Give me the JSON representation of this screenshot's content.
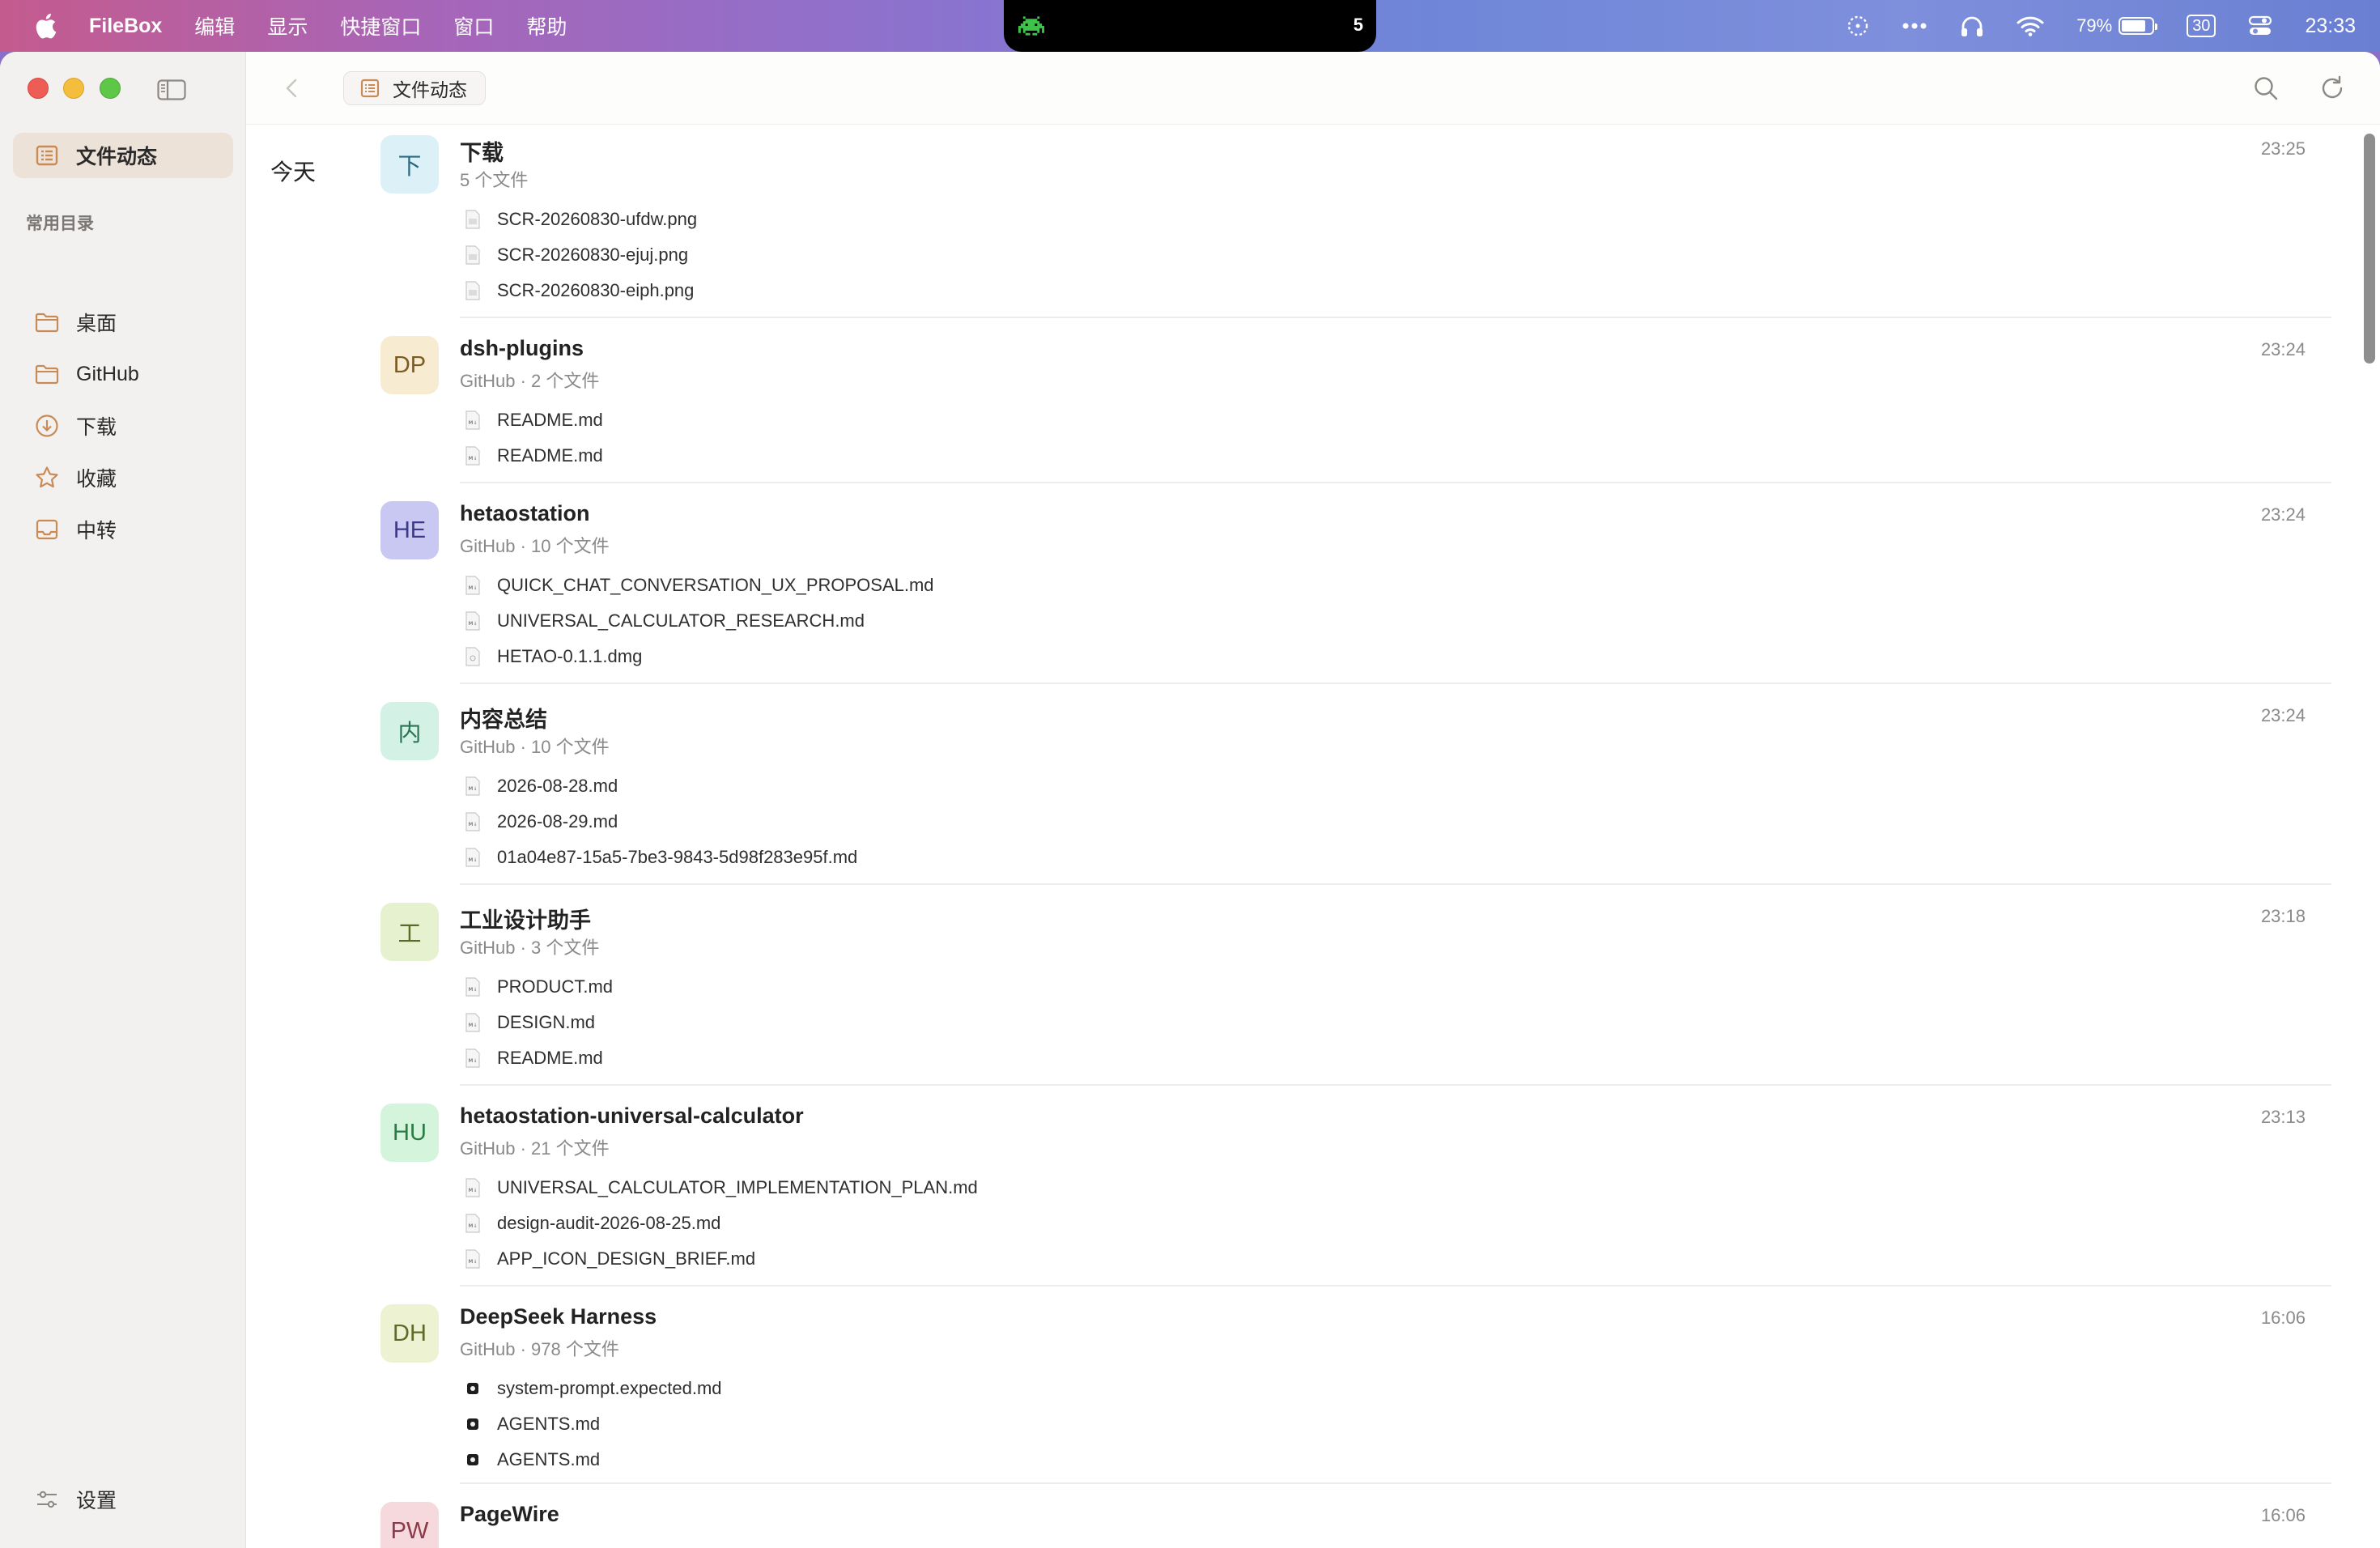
{
  "menubar": {
    "app_name": "FileBox",
    "menus": [
      "编辑",
      "显示",
      "快捷窗口",
      "窗口",
      "帮助"
    ],
    "notch_count": "5",
    "battery_percent": "79%",
    "battery_level": 0.79,
    "calendar_day": "30",
    "clock": "23:33"
  },
  "sidebar": {
    "active_item": {
      "label": "文件动态",
      "icon": "list-icon"
    },
    "section_title": "常用目录",
    "items": [
      {
        "label": "桌面",
        "icon": "folder-icon"
      },
      {
        "label": "GitHub",
        "icon": "folder-icon"
      },
      {
        "label": "下载",
        "icon": "download-icon"
      },
      {
        "label": "收藏",
        "icon": "star-icon"
      },
      {
        "label": "中转",
        "icon": "inbox-icon"
      }
    ],
    "settings_label": "设置"
  },
  "toolbar": {
    "breadcrumb": "文件动态"
  },
  "content": {
    "day_label": "今天",
    "groups": [
      {
        "avatar": "下",
        "avatar_bg": "#dbf0f7",
        "avatar_fg": "#2f6b80",
        "title": "下载",
        "subtitle": "5 个文件",
        "time": "23:25",
        "files": [
          {
            "name": "SCR-20260830-ufdw.png",
            "icon": "image-file-icon"
          },
          {
            "name": "SCR-20260830-ejuj.png",
            "icon": "image-file-icon"
          },
          {
            "name": "SCR-20260830-eiph.png",
            "icon": "image-file-icon"
          }
        ]
      },
      {
        "avatar": "DP",
        "avatar_bg": "#f7ecd2",
        "avatar_fg": "#7b5b22",
        "title": "dsh-plugins",
        "subtitle": "GitHub · 2 个文件",
        "time": "23:24",
        "files": [
          {
            "name": "README.md",
            "icon": "markdown-file-icon"
          },
          {
            "name": "README.md",
            "icon": "markdown-file-icon"
          }
        ]
      },
      {
        "avatar": "HE",
        "avatar_bg": "#c9c8f2",
        "avatar_fg": "#3b3a86",
        "title": "hetaostation",
        "subtitle": "GitHub · 10 个文件",
        "time": "23:24",
        "files": [
          {
            "name": "QUICK_CHAT_CONVERSATION_UX_PROPOSAL.md",
            "icon": "markdown-file-icon"
          },
          {
            "name": "UNIVERSAL_CALCULATOR_RESEARCH.md",
            "icon": "markdown-file-icon"
          },
          {
            "name": "HETAO-0.1.1.dmg",
            "icon": "disk-image-file-icon"
          }
        ]
      },
      {
        "avatar": "内",
        "avatar_bg": "#d3f2e5",
        "avatar_fg": "#2a7355",
        "title": "内容总结",
        "subtitle": "GitHub · 10 个文件",
        "time": "23:24",
        "files": [
          {
            "name": "2026-08-28.md",
            "icon": "markdown-file-icon"
          },
          {
            "name": "2026-08-29.md",
            "icon": "markdown-file-icon"
          },
          {
            "name": "01a04e87-15a5-7be3-9843-5d98f283e95f.md",
            "icon": "markdown-file-icon"
          }
        ]
      },
      {
        "avatar": "工",
        "avatar_bg": "#e6f2cf",
        "avatar_fg": "#556c26",
        "title": "工业设计助手",
        "subtitle": "GitHub · 3 个文件",
        "time": "23:18",
        "files": [
          {
            "name": "PRODUCT.md",
            "icon": "markdown-file-icon"
          },
          {
            "name": "DESIGN.md",
            "icon": "markdown-file-icon"
          },
          {
            "name": "README.md",
            "icon": "markdown-file-icon"
          }
        ]
      },
      {
        "avatar": "HU",
        "avatar_bg": "#d4f4dc",
        "avatar_fg": "#2c7a45",
        "title": "hetaostation-universal-calculator",
        "subtitle": "GitHub · 21 个文件",
        "time": "23:13",
        "files": [
          {
            "name": "UNIVERSAL_CALCULATOR_IMPLEMENTATION_PLAN.md",
            "icon": "markdown-file-icon"
          },
          {
            "name": "design-audit-2026-08-25.md",
            "icon": "markdown-file-icon"
          },
          {
            "name": "APP_ICON_DESIGN_BRIEF.md",
            "icon": "markdown-file-icon"
          }
        ]
      },
      {
        "avatar": "DH",
        "avatar_bg": "#edf2d3",
        "avatar_fg": "#5e6a2a",
        "title": "DeepSeek Harness",
        "subtitle": "GitHub · 978 个文件",
        "time": "16:06",
        "files": [
          {
            "name": "system-prompt.expected.md",
            "icon": "app-file-icon"
          },
          {
            "name": "AGENTS.md",
            "icon": "app-file-icon"
          },
          {
            "name": "AGENTS.md",
            "icon": "app-file-icon"
          }
        ]
      },
      {
        "avatar": "PW",
        "avatar_bg": "#f6d9dd",
        "avatar_fg": "#8a3a48",
        "title": "PageWire",
        "subtitle": "",
        "time": "16:06",
        "files": []
      }
    ]
  }
}
